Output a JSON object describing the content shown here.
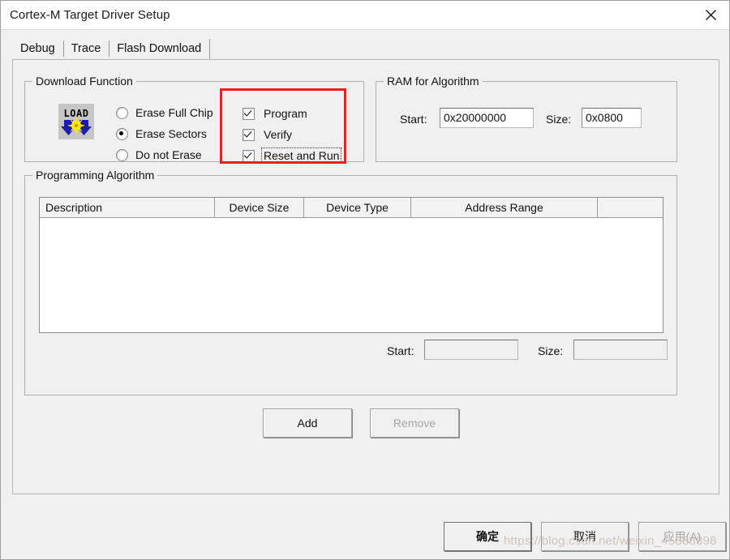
{
  "window": {
    "title": "Cortex-M Target Driver Setup",
    "close_icon": "close-icon"
  },
  "tabs": [
    {
      "label": "Debug",
      "active": false
    },
    {
      "label": "Trace",
      "active": false
    },
    {
      "label": "Flash Download",
      "active": true
    }
  ],
  "download_function": {
    "title": "Download Function",
    "icon": "load-flash-icon",
    "radios": [
      {
        "label": "Erase Full Chip",
        "checked": false
      },
      {
        "label": "Erase Sectors",
        "checked": true
      },
      {
        "label": "Do not Erase",
        "checked": false
      }
    ],
    "checkboxes": [
      {
        "label": "Program",
        "checked": true,
        "focused": false
      },
      {
        "label": "Verify",
        "checked": true,
        "focused": false
      },
      {
        "label": "Reset and Run",
        "checked": true,
        "focused": true
      }
    ]
  },
  "ram_for_algorithm": {
    "title": "RAM for Algorithm",
    "start_label": "Start:",
    "start_value": "0x20000000",
    "size_label": "Size:",
    "size_value": "0x0800"
  },
  "programming_algorithm": {
    "title": "Programming Algorithm",
    "columns": [
      "Description",
      "Device Size",
      "Device Type",
      "Address Range",
      ""
    ],
    "rows": [],
    "start_label": "Start:",
    "start_value": "",
    "size_label": "Size:",
    "size_value": ""
  },
  "buttons": {
    "add": {
      "label": "Add",
      "enabled": true
    },
    "remove": {
      "label": "Remove",
      "enabled": false
    },
    "ok": {
      "label": "确定",
      "enabled": true,
      "default": true
    },
    "cancel": {
      "label": "取消",
      "enabled": true
    },
    "apply": {
      "label": "应用(A)",
      "enabled": false
    }
  },
  "annotation": {
    "highlight_color": "#ee1c1c"
  },
  "watermark": {
    "text": "https://blog.csdn.net/weixin_45888898"
  }
}
